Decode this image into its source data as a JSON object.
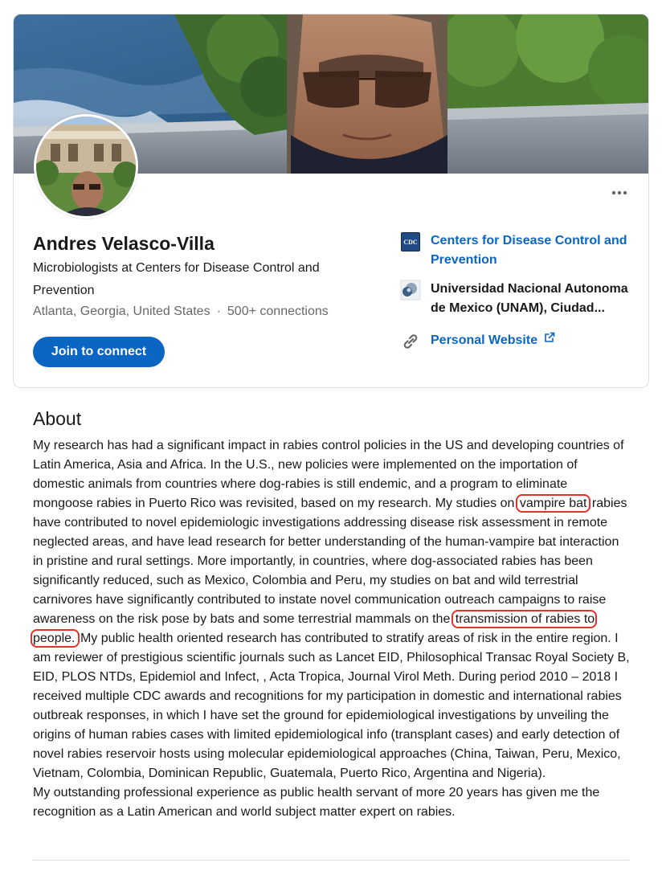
{
  "profile": {
    "name": "Andres Velasco-Villa",
    "headline": "Microbiologists at Centers for Disease Control and Prevention",
    "location": "Atlanta, Georgia, United States",
    "separator": "·",
    "connections": "500+ connections",
    "join_label": "Join to connect",
    "more_label": "More actions"
  },
  "side_links": [
    {
      "label": "Centers for Disease Control and Prevention",
      "icon": "cdc-logo-icon",
      "logo_text": "CDC",
      "link": true
    },
    {
      "label": "Universidad Nacional Autonoma de Mexico (UNAM), Ciudad...",
      "icon": "university-logo-icon",
      "link": false
    },
    {
      "label": "Personal Website",
      "icon": "link-icon",
      "external": "external-link-icon",
      "link": true
    }
  ],
  "about": {
    "title": "About",
    "p1_a": "My research has had a significant impact in rabies control policies in the US and developing countries of Latin America, Asia and Africa. In the U.S., new policies were implemented on the importation of domestic animals from countries where dog-rabies is still endemic, and a program to eliminate mongoose rabies in Puerto Rico was revisited, based on my research. My studies on ",
    "h1": "vampire bat",
    "p1_b": " rabies have contributed to novel epidemiologic investigations addressing disease risk assessment in remote neglected areas, and have lead research for better understanding of the human-vampire bat interaction in pristine and rural settings. More importantly, in countries, where dog-associated rabies has been significantly reduced, such as Mexico, Colombia and Peru, my studies on bat and wild terrestrial carnivores have significantly contributed to instate novel communication outreach campaigns to raise awareness on the risk pose by bats and some terrestrial mammals on the ",
    "h2": "transmission of rabies to people.",
    "p1_c": " My public health oriented research has contributed to stratify areas of risk in the entire region. I am reviewer of prestigious scientific journals such as Lancet EID, Philosophical Transac Royal Society B, EID, PLOS NTDs, Epidemiol and Infect, , Acta Tropica, Journal Virol Meth. During period 2010 – 2018 I received multiple CDC awards and recognitions for my participation in domestic and international rabies outbreak responses, in which I have set the ground for epidemiological investigations by unveiling the origins of human rabies cases with limited epidemiological info (transplant cases) and early detection of novel rabies reservoir hosts using molecular epidemiological approaches (China, Taiwan, Peru, Mexico, Vietnam, Colombia, Dominican Republic, Guatemala, Puerto Rico, Argentina and Nigeria).",
    "p2": "My outstanding professional experience as public health servant of more 20 years has given me the recognition as a Latin American and world subject matter expert on rabies."
  },
  "colors": {
    "accent": "#0a66c2",
    "highlight_box": "#e0332b",
    "cdc_blue": "#1f4a82"
  }
}
